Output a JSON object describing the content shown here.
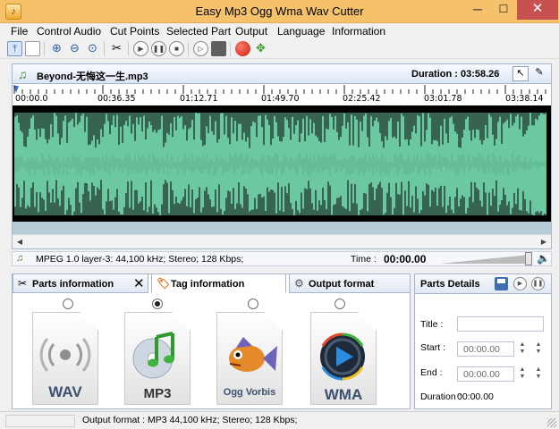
{
  "window": {
    "title": "Easy Mp3 Ogg Wma Wav Cutter",
    "minimize_glyph": "─",
    "maximize_glyph": "☐",
    "close_glyph": "✕"
  },
  "menu": [
    "File",
    "Control Audio",
    "Cut Points",
    "Selected Part",
    "Output",
    "Language",
    "Information"
  ],
  "toolbar": {
    "icons": [
      "open-file-icon",
      "new-file-icon",
      "zoom-in-icon",
      "zoom-out-icon",
      "zoom-fit-icon",
      "cut-icon",
      "play-icon",
      "pause-icon",
      "stop-icon",
      "play-selection-icon",
      "save-icon",
      "record-icon",
      "split-icon"
    ]
  },
  "waveform": {
    "file_name": "Beyond-无悔这一生.mp3",
    "duration_label": "Duration : 03:58.26",
    "ticks": [
      "00:00.0",
      "00:36.35",
      "01:12.71",
      "01:49.70",
      "02:25.42",
      "03:01.78",
      "03:38.14"
    ],
    "colors": {
      "wave": "#6cc8a0",
      "background": "#000000",
      "bottom_band": "#b8ccd8"
    }
  },
  "info_bar": {
    "format_text": "MPEG 1.0 layer-3: 44,100 kHz; Stereo; 128 Kbps;",
    "time_label": "Time :",
    "time_value": "00:00.00"
  },
  "tabs": [
    {
      "label": "Parts information",
      "icon": "scissors-icon"
    },
    {
      "label": "Tag information",
      "icon": "tag-icon"
    },
    {
      "label": "Output format",
      "icon": "gear-icon"
    }
  ],
  "tab_close_glyph": "✕",
  "formats": [
    {
      "label": "WAV",
      "selected": false
    },
    {
      "label": "MP3",
      "selected": true
    },
    {
      "label": "Ogg Vorbis",
      "selected": false
    },
    {
      "label": "WMA",
      "selected": false
    }
  ],
  "parts_details": {
    "title": "Parts Details",
    "title_label": "Title :",
    "title_value": "",
    "start_label": "Start :",
    "start_value": "00:00.00",
    "end_label": "End :",
    "end_value": "00:00.00",
    "duration_label": "Duration :",
    "duration_value": "00:00.00"
  },
  "status_bar": {
    "text": "Output format : MP3 44,100 kHz; Stereo;  128 Kbps;"
  }
}
